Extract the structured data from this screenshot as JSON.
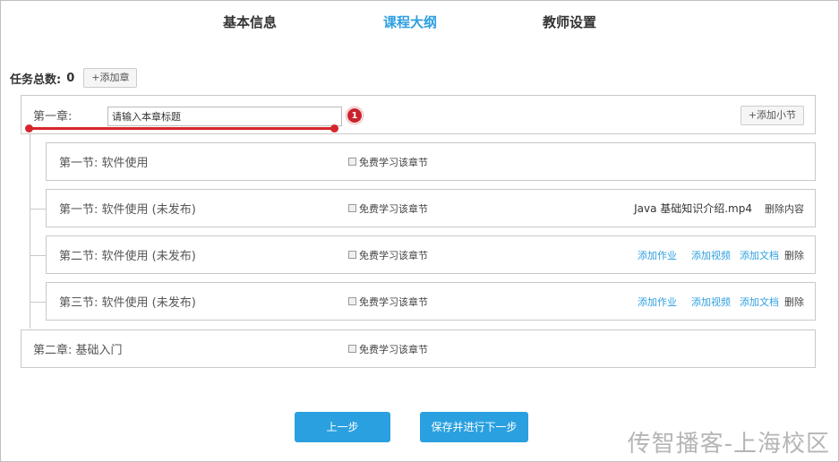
{
  "tabs": [
    {
      "label": "基本信息",
      "active": false
    },
    {
      "label": "课程大纲",
      "active": true
    },
    {
      "label": "教师设置",
      "active": false
    }
  ],
  "task": {
    "label": "任务总数:",
    "count": "0",
    "add_chapter": "+添加章"
  },
  "chapter1": {
    "title": "第一章:",
    "input_value": "请输入本章标题",
    "add_section": "+添加小节",
    "marker": "1"
  },
  "free_label": "免费学习该章节",
  "sections": [
    {
      "title": "第一节: 软件使用"
    },
    {
      "title": "第一节: 软件使用 (未发布)",
      "file": "Java 基础知识介绍.mp4",
      "delete_content": "删除内容"
    },
    {
      "title": "第二节: 软件使用 (未发布)"
    },
    {
      "title": "第三节: 软件使用 (未发布)"
    }
  ],
  "actions": {
    "add_homework": "添加作业",
    "add_video": "添加视频",
    "add_doc": "添加文档",
    "delete": "删除"
  },
  "chapter2": {
    "title": "第二章: 基础入门"
  },
  "buttons": {
    "prev": "上一步",
    "save_next": "保存并进行下一步"
  },
  "watermark": "传智播客-上海校区",
  "colors": {
    "accent": "#2ea0e0",
    "annotation": "#d6262c"
  }
}
